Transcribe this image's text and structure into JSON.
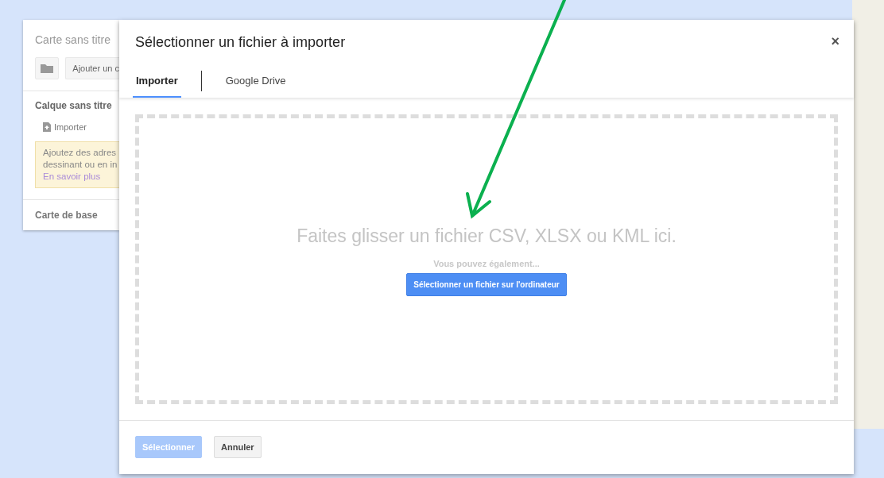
{
  "map_panel": {
    "title": "Carte sans titre",
    "add_button": "Ajouter un c",
    "layer": {
      "title": "Calque sans titre",
      "import_link": "Importer",
      "hint_lines": [
        "Ajoutez des adres",
        "dessinant ou en in"
      ],
      "hint_link": "En savoir plus"
    },
    "base_map": "Carte de base"
  },
  "dialog": {
    "title": "Sélectionner un fichier à importer",
    "close": "×",
    "tabs": [
      {
        "label": "Importer",
        "selected": true
      },
      {
        "label": "Google Drive",
        "selected": false
      }
    ],
    "drop_zone": {
      "message": "Faites glisser un fichier CSV, XLSX ou KML ici.",
      "subtitle": "Vous pouvez également...",
      "button": "Sélectionner un fichier sur l'ordinateur"
    },
    "footer": [
      {
        "label": "Sélectionner",
        "kind": "primary",
        "disabled": true
      },
      {
        "label": "Annuler",
        "kind": "secondary",
        "disabled": false
      }
    ]
  }
}
